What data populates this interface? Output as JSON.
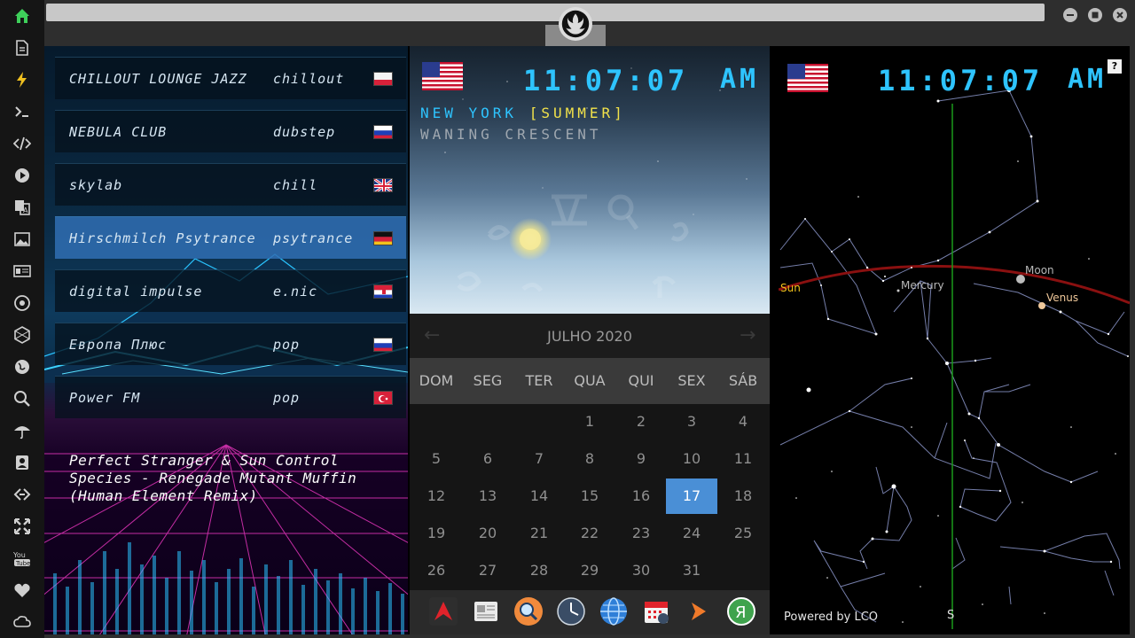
{
  "sidebar": {
    "icons": [
      "home-icon",
      "file-icon",
      "bolt-icon",
      "terminal-icon",
      "code-icon",
      "play-icon",
      "translate-icon",
      "image-icon",
      "news-icon",
      "rebel-icon",
      "hexagon-icon",
      "globe-icon",
      "search-icon",
      "umbrella-icon",
      "contact-icon",
      "link-icon",
      "fullscreen-icon",
      "youtube-icon",
      "heart-icon",
      "cloud-icon"
    ]
  },
  "window": {
    "controls": [
      "minimize",
      "maximize",
      "close"
    ]
  },
  "radio": {
    "stations": [
      {
        "name": "CHILLOUT LOUNGE JAZZ",
        "genre": "chillout",
        "flag": "poland"
      },
      {
        "name": "NEBULA CLUB",
        "genre": "dubstep",
        "flag": "russia"
      },
      {
        "name": "skylab",
        "genre": "chill",
        "flag": "uk"
      },
      {
        "name": "Hirschmilch Psytrance",
        "genre": "psytrance",
        "flag": "germany"
      },
      {
        "name": "digital impulse",
        "genre": "e.nic",
        "flag": "croatia"
      },
      {
        "name": "Европа Плюс",
        "genre": "pop",
        "flag": "russia"
      },
      {
        "name": "Power FM",
        "genre": "pop",
        "flag": "turkey"
      }
    ],
    "now_playing": [
      "Perfect Stranger & Sun Control",
      "Species - Renegade Mutant Muffin",
      "(Human Element Remix)"
    ]
  },
  "clock": {
    "time": "11:07:07",
    "ampm": "AM",
    "city": "NEW YORK",
    "season": "[SUMMER]",
    "moon_phase": "WANING CRESCENT"
  },
  "calendar": {
    "title": "JULHO 2020",
    "weekdays": [
      "DOM",
      "SEG",
      "TER",
      "QUA",
      "QUI",
      "SEX",
      "SÁB"
    ],
    "weeks": [
      [
        "",
        "",
        "",
        "1",
        "2",
        "3",
        "4"
      ],
      [
        "5",
        "6",
        "7",
        "8",
        "9",
        "10",
        "11"
      ],
      [
        "12",
        "13",
        "14",
        "15",
        "16",
        "17",
        "18"
      ],
      [
        "19",
        "20",
        "21",
        "22",
        "23",
        "24",
        "25"
      ],
      [
        "26",
        "27",
        "28",
        "29",
        "30",
        "31",
        ""
      ]
    ],
    "today": "17"
  },
  "dock": {
    "icons": [
      "app-red-icon",
      "news-reader-icon",
      "search-app-icon",
      "clock-app-icon",
      "browser-icon",
      "calendar-app-icon",
      "arrow-app-icon",
      "yandex-icon"
    ]
  },
  "starmap": {
    "clock_time": "11:07:07",
    "clock_ampm": "AM",
    "planets": {
      "sun": "Sun",
      "mercury": "Mercury",
      "moon": "Moon",
      "venus": "Venus"
    },
    "help": "?",
    "powered_by": "Powered by LCO",
    "south": "S"
  }
}
